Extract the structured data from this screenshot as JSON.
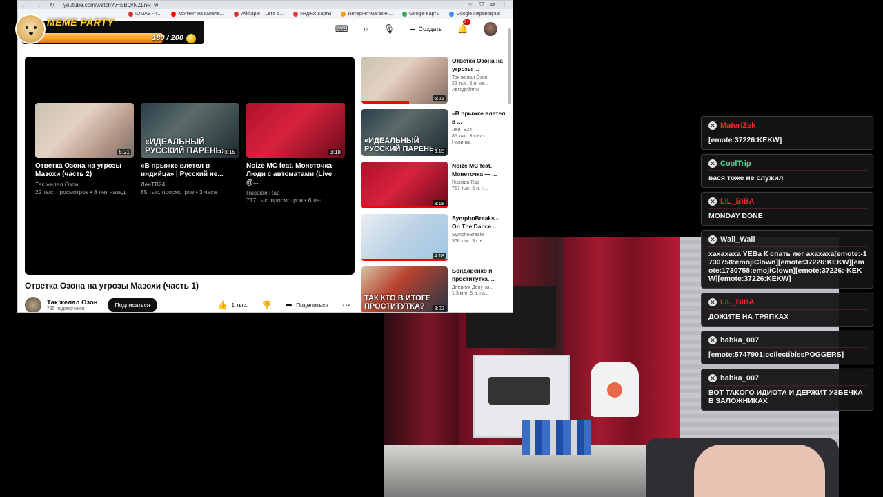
{
  "browser": {
    "url": "youtube.com/watch?v=EBQrNZLnR_w",
    "bookmarks": [
      {
        "label": "IOMAS - Y...",
        "color": "#d93025"
      },
      {
        "label": "Контент на канале...",
        "color": "#ff0000"
      },
      {
        "label": "Wikitaple – Let's d...",
        "color": "#d93025"
      },
      {
        "label": "Яндекс Карты",
        "color": "#e53935"
      },
      {
        "label": "Интернет-магазин...",
        "color": "#f4a000"
      },
      {
        "label": "Google Карты",
        "color": "#34a853"
      },
      {
        "label": "Google Переводчик",
        "color": "#4285f4"
      }
    ]
  },
  "header": {
    "create_label": "Создать",
    "notification_count": "9+"
  },
  "endcards": [
    {
      "title": "Ответка Озона на угрозы Мазохи (часть 2)",
      "channel": "Так желал Озон",
      "meta": "22 тыс. просмотров • 8 лет назад",
      "duration": "5:21",
      "overlay": ""
    },
    {
      "title": "«В прыжке влетел в индийца» | Русский не...",
      "channel": "ЛенТВ24",
      "meta": "85 тыс. просмотров • 3 часа",
      "duration": "3:15",
      "overlay": "«ИДЕАЛЬНЫЙ РУССКИЙ ПАРЕНЬ»"
    },
    {
      "title": "Noize MC feat. Монеточка — Люди с автоматами (Live @...",
      "channel": "Russian Rap",
      "meta": "717 тыс. просмотров • 6 лет",
      "duration": "3:18",
      "overlay": ""
    }
  ],
  "video": {
    "title": "Ответка Озона на угрозы Мазохи (часть 1)",
    "channel": "Так желал Озон",
    "subscribers": "735 подписчиков",
    "subscribe_label": "Подписаться",
    "likes": "1 тыс.",
    "share_label": "Поделиться"
  },
  "sidebar": [
    {
      "title": "Ответка Озона на угрозы ...",
      "channel": "Так желал Озон",
      "stats": "22 тыс. 8 л. на...",
      "tag": "Автодубляж",
      "duration": "5:21",
      "overlay": "",
      "progress": 0.55
    },
    {
      "title": "«В прыжке влетел в ...",
      "channel": "ЛенТВ24",
      "stats": "85 тыс. 3 ч наз...",
      "tag": "Новинка",
      "duration": "3:15",
      "overlay": "«ИДЕАЛЬНЫЙ РУССКИЙ ПАРЕНЬ»",
      "progress": 0
    },
    {
      "title": "Noize MC feat. Монеточка — ...",
      "channel": "Russian Rap",
      "stats": "717 тыс. 6 л. н...",
      "tag": "",
      "duration": "3:18",
      "overlay": "",
      "progress": 1.0
    },
    {
      "title": "SymphoBreaks - On The Dance ...",
      "channel": "SymphoBreaks",
      "stats": "368 тыс. 3 г. н...",
      "tag": "",
      "duration": "4:18",
      "overlay": "",
      "progress": 1.0
    },
    {
      "title": "Бондаренко и проститутка. ...",
      "channel": "Дневник Депутат...",
      "stats": "1,3 млн 5 л. на...",
      "tag": "",
      "duration": "8:02",
      "overlay": "ТАК КТО В ИТОГЕ ПРОСТИТУТКА?",
      "progress": 0
    }
  ],
  "meme_party": {
    "label": "MEME PARTY",
    "count": "180 / 200",
    "progress": 0.9
  },
  "chat": [
    {
      "user": "MateriZek",
      "color": "#ff2a2a",
      "text": "[emote:37226:KEKW]"
    },
    {
      "user": "CoolTrip",
      "color": "#4ed89a",
      "text": "вася тоже не служил"
    },
    {
      "user": "LIL_BIBA",
      "color": "#ff2a2a",
      "text": "MONDAY DONE"
    },
    {
      "user": "Wall_Wall",
      "color": "#e8e8e8",
      "text": "хахахаха YEBa К спать лег ахахаха[emote:-1730758:emojiClown][emote:37226:KEKW][emote:1730758:emojiClown][emote:37226:-KEKW][emote:37226:KEKW]"
    },
    {
      "user": "LIL_BIBA",
      "color": "#ff2a2a",
      "text": "ДОЖИТЕ НА ТРЯПКАХ"
    },
    {
      "user": "babka_007",
      "color": "#e8e8e8",
      "text": "[emote:5747901:collectiblesPOGGERS]"
    },
    {
      "user": "babka_007",
      "color": "#e8e8e8",
      "text": "ВОТ ТАКОГО ИДИОТА И ДЕРЖИТ УЗБЕЧКА В ЗАЛОЖНИКАХ"
    }
  ]
}
